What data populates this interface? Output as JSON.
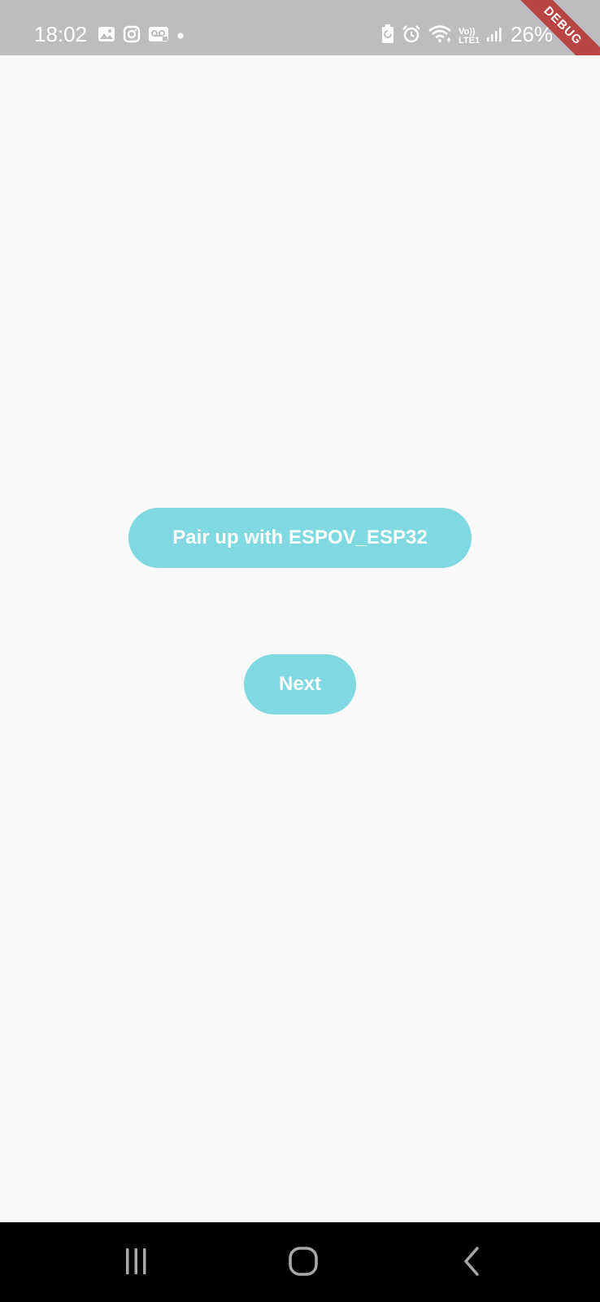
{
  "status_bar": {
    "time": "18:02",
    "battery": "26%",
    "left_icons": [
      "gallery-icon",
      "instagram-icon",
      "voicemail-icon",
      "dot-icon"
    ],
    "right_icons": [
      "battery-saver-icon",
      "alarm-icon",
      "wifi-icon",
      "volte-icon",
      "signal-icon"
    ],
    "volte_line1": "Vo))",
    "volte_line2": "LTE1"
  },
  "debug_banner": {
    "label": "DEBUG"
  },
  "main": {
    "pair_button_label": "Pair up with ESPOV_ESP32",
    "next_button_label": "Next"
  },
  "nav_bar": {
    "items": [
      "recent-apps-icon",
      "home-icon",
      "back-icon"
    ]
  },
  "colors": {
    "accent": "#80d8e0",
    "status_bar": "#bdbdbd",
    "background": "#fafafa",
    "nav_bar": "#000000",
    "debug_banner": "#b71c1c"
  }
}
